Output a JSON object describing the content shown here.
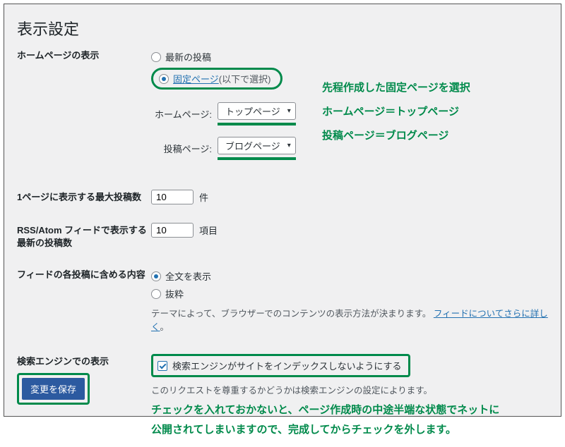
{
  "heading": "表示設定",
  "homepage": {
    "label": "ホームページの表示",
    "opt_latest": "最新の投稿",
    "opt_fixed_link": "固定ページ",
    "opt_fixed_suffix": " (以下で選択)",
    "sub_home_label": "ホームページ:",
    "sub_posts_label": "投稿ページ:",
    "select_home": "トップページ",
    "select_posts": "ブログページ"
  },
  "notes": {
    "line1": "先程作成した固定ページを選択",
    "line2": "ホームページ＝トップページ",
    "line3": "投稿ページ＝ブログページ"
  },
  "per_page": {
    "label": "1ページに表示する最大投稿数",
    "value": "10",
    "unit": "件"
  },
  "rss": {
    "label": "RSS/Atom フィードで表示する最新の投稿数",
    "value": "10",
    "unit": "項目"
  },
  "feed_content": {
    "label": "フィードの各投稿に含める内容",
    "opt_full": "全文を表示",
    "opt_excerpt": "抜粋",
    "desc_prefix": "テーマによって、ブラウザーでのコンテンツの表示方法が決まります。",
    "desc_link": "フィードについてさらに詳しく",
    "desc_suffix": "。"
  },
  "search_engine": {
    "label": "検索エンジンでの表示",
    "checkbox_label": "検索エンジンがサイトをインデックスしないようにする",
    "desc": "このリクエストを尊重するかどうかは検索エンジンの設定によります。",
    "note1": "チェックを入れておかないと、ページ作成時の中途半端な状態でネットに",
    "note2": "公開されてしまいますので、完成してからチェックを外します。"
  },
  "save_button": "変更を保存"
}
